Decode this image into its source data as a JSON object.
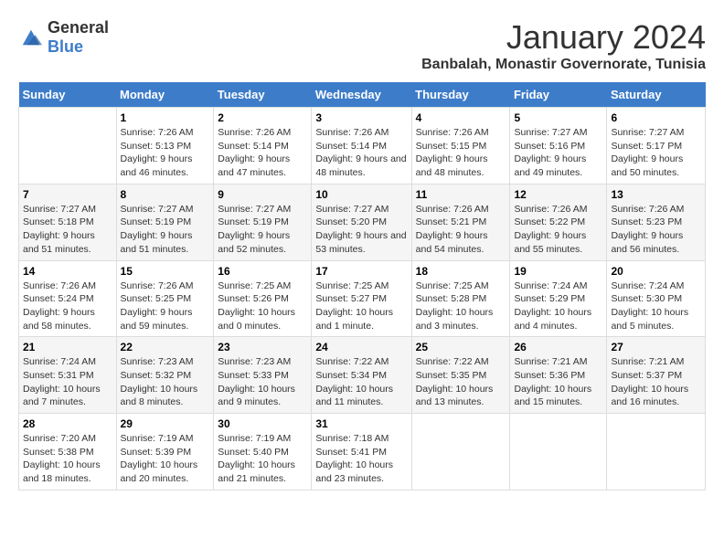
{
  "logo": {
    "text_general": "General",
    "text_blue": "Blue"
  },
  "title": "January 2024",
  "subtitle": "Banbalah, Monastir Governorate, Tunisia",
  "headers": [
    "Sunday",
    "Monday",
    "Tuesday",
    "Wednesday",
    "Thursday",
    "Friday",
    "Saturday"
  ],
  "weeks": [
    [
      {
        "day": "",
        "sunrise": "",
        "sunset": "",
        "daylight": ""
      },
      {
        "day": "1",
        "sunrise": "Sunrise: 7:26 AM",
        "sunset": "Sunset: 5:13 PM",
        "daylight": "Daylight: 9 hours and 46 minutes."
      },
      {
        "day": "2",
        "sunrise": "Sunrise: 7:26 AM",
        "sunset": "Sunset: 5:14 PM",
        "daylight": "Daylight: 9 hours and 47 minutes."
      },
      {
        "day": "3",
        "sunrise": "Sunrise: 7:26 AM",
        "sunset": "Sunset: 5:14 PM",
        "daylight": "Daylight: 9 hours and 48 minutes."
      },
      {
        "day": "4",
        "sunrise": "Sunrise: 7:26 AM",
        "sunset": "Sunset: 5:15 PM",
        "daylight": "Daylight: 9 hours and 48 minutes."
      },
      {
        "day": "5",
        "sunrise": "Sunrise: 7:27 AM",
        "sunset": "Sunset: 5:16 PM",
        "daylight": "Daylight: 9 hours and 49 minutes."
      },
      {
        "day": "6",
        "sunrise": "Sunrise: 7:27 AM",
        "sunset": "Sunset: 5:17 PM",
        "daylight": "Daylight: 9 hours and 50 minutes."
      }
    ],
    [
      {
        "day": "7",
        "sunrise": "Sunrise: 7:27 AM",
        "sunset": "Sunset: 5:18 PM",
        "daylight": "Daylight: 9 hours and 51 minutes."
      },
      {
        "day": "8",
        "sunrise": "Sunrise: 7:27 AM",
        "sunset": "Sunset: 5:19 PM",
        "daylight": "Daylight: 9 hours and 51 minutes."
      },
      {
        "day": "9",
        "sunrise": "Sunrise: 7:27 AM",
        "sunset": "Sunset: 5:19 PM",
        "daylight": "Daylight: 9 hours and 52 minutes."
      },
      {
        "day": "10",
        "sunrise": "Sunrise: 7:27 AM",
        "sunset": "Sunset: 5:20 PM",
        "daylight": "Daylight: 9 hours and 53 minutes."
      },
      {
        "day": "11",
        "sunrise": "Sunrise: 7:26 AM",
        "sunset": "Sunset: 5:21 PM",
        "daylight": "Daylight: 9 hours and 54 minutes."
      },
      {
        "day": "12",
        "sunrise": "Sunrise: 7:26 AM",
        "sunset": "Sunset: 5:22 PM",
        "daylight": "Daylight: 9 hours and 55 minutes."
      },
      {
        "day": "13",
        "sunrise": "Sunrise: 7:26 AM",
        "sunset": "Sunset: 5:23 PM",
        "daylight": "Daylight: 9 hours and 56 minutes."
      }
    ],
    [
      {
        "day": "14",
        "sunrise": "Sunrise: 7:26 AM",
        "sunset": "Sunset: 5:24 PM",
        "daylight": "Daylight: 9 hours and 58 minutes."
      },
      {
        "day": "15",
        "sunrise": "Sunrise: 7:26 AM",
        "sunset": "Sunset: 5:25 PM",
        "daylight": "Daylight: 9 hours and 59 minutes."
      },
      {
        "day": "16",
        "sunrise": "Sunrise: 7:25 AM",
        "sunset": "Sunset: 5:26 PM",
        "daylight": "Daylight: 10 hours and 0 minutes."
      },
      {
        "day": "17",
        "sunrise": "Sunrise: 7:25 AM",
        "sunset": "Sunset: 5:27 PM",
        "daylight": "Daylight: 10 hours and 1 minute."
      },
      {
        "day": "18",
        "sunrise": "Sunrise: 7:25 AM",
        "sunset": "Sunset: 5:28 PM",
        "daylight": "Daylight: 10 hours and 3 minutes."
      },
      {
        "day": "19",
        "sunrise": "Sunrise: 7:24 AM",
        "sunset": "Sunset: 5:29 PM",
        "daylight": "Daylight: 10 hours and 4 minutes."
      },
      {
        "day": "20",
        "sunrise": "Sunrise: 7:24 AM",
        "sunset": "Sunset: 5:30 PM",
        "daylight": "Daylight: 10 hours and 5 minutes."
      }
    ],
    [
      {
        "day": "21",
        "sunrise": "Sunrise: 7:24 AM",
        "sunset": "Sunset: 5:31 PM",
        "daylight": "Daylight: 10 hours and 7 minutes."
      },
      {
        "day": "22",
        "sunrise": "Sunrise: 7:23 AM",
        "sunset": "Sunset: 5:32 PM",
        "daylight": "Daylight: 10 hours and 8 minutes."
      },
      {
        "day": "23",
        "sunrise": "Sunrise: 7:23 AM",
        "sunset": "Sunset: 5:33 PM",
        "daylight": "Daylight: 10 hours and 9 minutes."
      },
      {
        "day": "24",
        "sunrise": "Sunrise: 7:22 AM",
        "sunset": "Sunset: 5:34 PM",
        "daylight": "Daylight: 10 hours and 11 minutes."
      },
      {
        "day": "25",
        "sunrise": "Sunrise: 7:22 AM",
        "sunset": "Sunset: 5:35 PM",
        "daylight": "Daylight: 10 hours and 13 minutes."
      },
      {
        "day": "26",
        "sunrise": "Sunrise: 7:21 AM",
        "sunset": "Sunset: 5:36 PM",
        "daylight": "Daylight: 10 hours and 15 minutes."
      },
      {
        "day": "27",
        "sunrise": "Sunrise: 7:21 AM",
        "sunset": "Sunset: 5:37 PM",
        "daylight": "Daylight: 10 hours and 16 minutes."
      }
    ],
    [
      {
        "day": "28",
        "sunrise": "Sunrise: 7:20 AM",
        "sunset": "Sunset: 5:38 PM",
        "daylight": "Daylight: 10 hours and 18 minutes."
      },
      {
        "day": "29",
        "sunrise": "Sunrise: 7:19 AM",
        "sunset": "Sunset: 5:39 PM",
        "daylight": "Daylight: 10 hours and 20 minutes."
      },
      {
        "day": "30",
        "sunrise": "Sunrise: 7:19 AM",
        "sunset": "Sunset: 5:40 PM",
        "daylight": "Daylight: 10 hours and 21 minutes."
      },
      {
        "day": "31",
        "sunrise": "Sunrise: 7:18 AM",
        "sunset": "Sunset: 5:41 PM",
        "daylight": "Daylight: 10 hours and 23 minutes."
      },
      {
        "day": "",
        "sunrise": "",
        "sunset": "",
        "daylight": ""
      },
      {
        "day": "",
        "sunrise": "",
        "sunset": "",
        "daylight": ""
      },
      {
        "day": "",
        "sunrise": "",
        "sunset": "",
        "daylight": ""
      }
    ]
  ]
}
